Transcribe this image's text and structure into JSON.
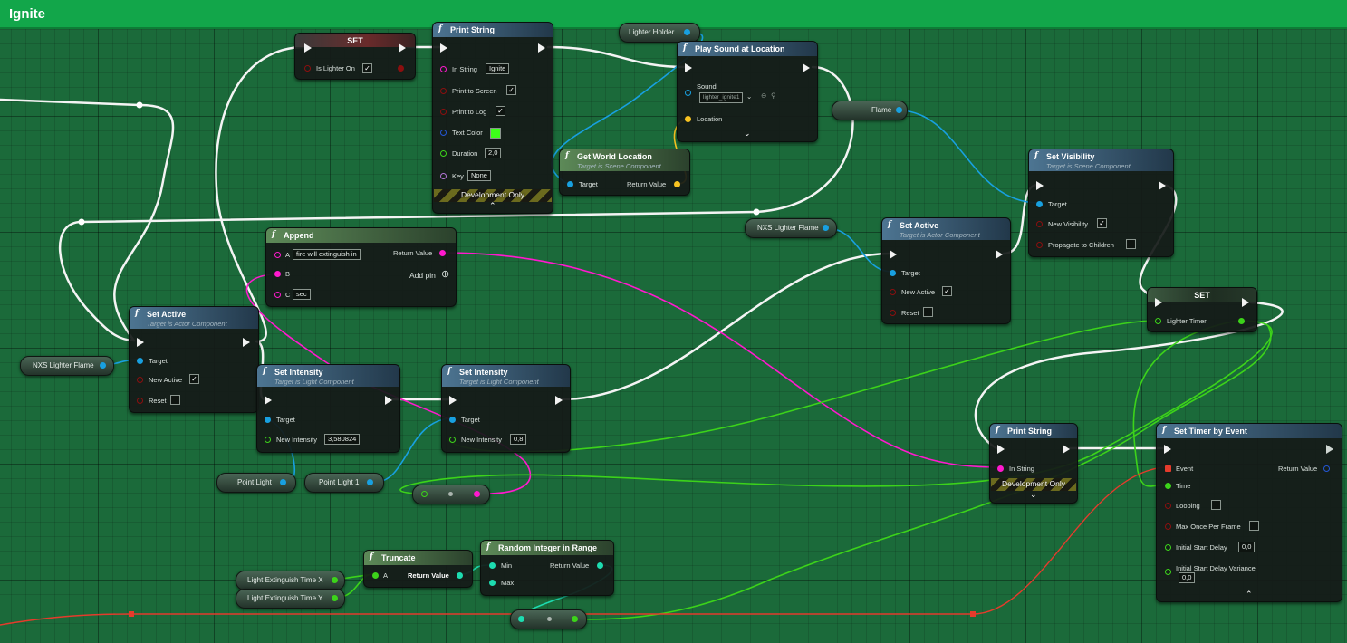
{
  "graph": {
    "title": "Ignite"
  },
  "colors": {
    "exec": "#ffffff",
    "object": "#18a0e0",
    "boolean": "#8c0f0f",
    "float": "#3cd31a",
    "integer": "#1ddcb0",
    "string": "#ff19ce",
    "linear_color": "#2457d6",
    "vector": "#f8c321",
    "name": "#b576d8",
    "delegate": "#e53b2c"
  },
  "nodes": {
    "set_lighter_on": {
      "title": "SET",
      "pin_label": "Is Lighter On",
      "checked": "✓"
    },
    "print_string_1": {
      "title": "Print String",
      "in_string_label": "In String",
      "in_string_value": "Ignite",
      "print_to_screen_label": "Print to Screen",
      "print_to_screen_checked": "✓",
      "print_to_log_label": "Print to Log",
      "print_to_log_checked": "✓",
      "text_color_label": "Text Color",
      "duration_label": "Duration",
      "duration_value": "2,0",
      "key_label": "Key",
      "key_value": "None",
      "dev_only": "Development Only"
    },
    "lighter_holder": {
      "label": "Lighter Holder"
    },
    "play_sound": {
      "title": "Play Sound at Location",
      "sound_label": "Sound",
      "sound_value": "lighter_ignite1",
      "location_label": "Location"
    },
    "flame": {
      "label": "Flame"
    },
    "get_world_location": {
      "title": "Get World Location",
      "subtitle": "Target is Scene Component",
      "target_label": "Target",
      "return_label": "Return Value"
    },
    "set_visibility": {
      "title": "Set Visibility",
      "subtitle": "Target is Scene Component",
      "target_label": "Target",
      "new_visibility_label": "New Visibility",
      "new_visibility_checked": "✓",
      "propagate_label": "Propagate to Children",
      "propagate_checked": ""
    },
    "nxs_lighter_flame_right": {
      "label": "NXS Lighter Flame"
    },
    "set_active_right": {
      "title": "Set Active",
      "subtitle": "Target is Actor Component",
      "target_label": "Target",
      "new_active_label": "New Active",
      "new_active_checked": "✓",
      "reset_label": "Reset",
      "reset_checked": ""
    },
    "set_lighter_timer": {
      "title": "SET",
      "pin_label": "Lighter Timer"
    },
    "append": {
      "title": "Append",
      "a_label": "A",
      "a_value": "fire will extinguish in",
      "b_label": "B",
      "c_label": "C",
      "c_value": "sec",
      "return_label": "Return Value",
      "add_pin_label": "Add pin"
    },
    "set_active_left": {
      "title": "Set Active",
      "subtitle": "Target is Actor Component",
      "target_label": "Target",
      "new_active_label": "New Active",
      "new_active_checked": "✓",
      "reset_label": "Reset",
      "reset_checked": ""
    },
    "nxs_lighter_flame_left": {
      "label": "NXS Lighter Flame"
    },
    "set_intensity_1": {
      "title": "Set Intensity",
      "subtitle": "Target is Light Component",
      "target_label": "Target",
      "new_intensity_label": "New Intensity",
      "new_intensity_value": "3,580824"
    },
    "set_intensity_2": {
      "title": "Set Intensity",
      "subtitle": "Target is Light Component",
      "target_label": "Target",
      "new_intensity_label": "New Intensity",
      "new_intensity_value": "0,8"
    },
    "point_light": {
      "label": "Point Light"
    },
    "point_light_1": {
      "label": "Point Light 1"
    },
    "print_string_2": {
      "title": "Print String",
      "in_string_label": "In String",
      "dev_only": "Development Only"
    },
    "set_timer_by_event": {
      "title": "Set Timer by Event",
      "event_label": "Event",
      "return_label": "Return Value",
      "time_label": "Time",
      "looping_label": "Looping",
      "looping_checked": "",
      "max_once_label": "Max Once Per Frame",
      "max_once_checked": "",
      "initial_delay_label": "Initial Start Delay",
      "initial_delay_value": "0,0",
      "initial_variance_label": "Initial Start Delay Variance",
      "initial_variance_value": "0,0"
    },
    "light_ext_x": {
      "label": "Light Extinguish Time X"
    },
    "light_ext_y": {
      "label": "Light Extinguish Time Y"
    },
    "truncate": {
      "title": "Truncate",
      "a_label": "A",
      "return_label": "Return Value"
    },
    "random_int": {
      "title": "Random Integer in Range",
      "min_label": "Min",
      "max_label": "Max",
      "return_label": "Return Value"
    }
  }
}
